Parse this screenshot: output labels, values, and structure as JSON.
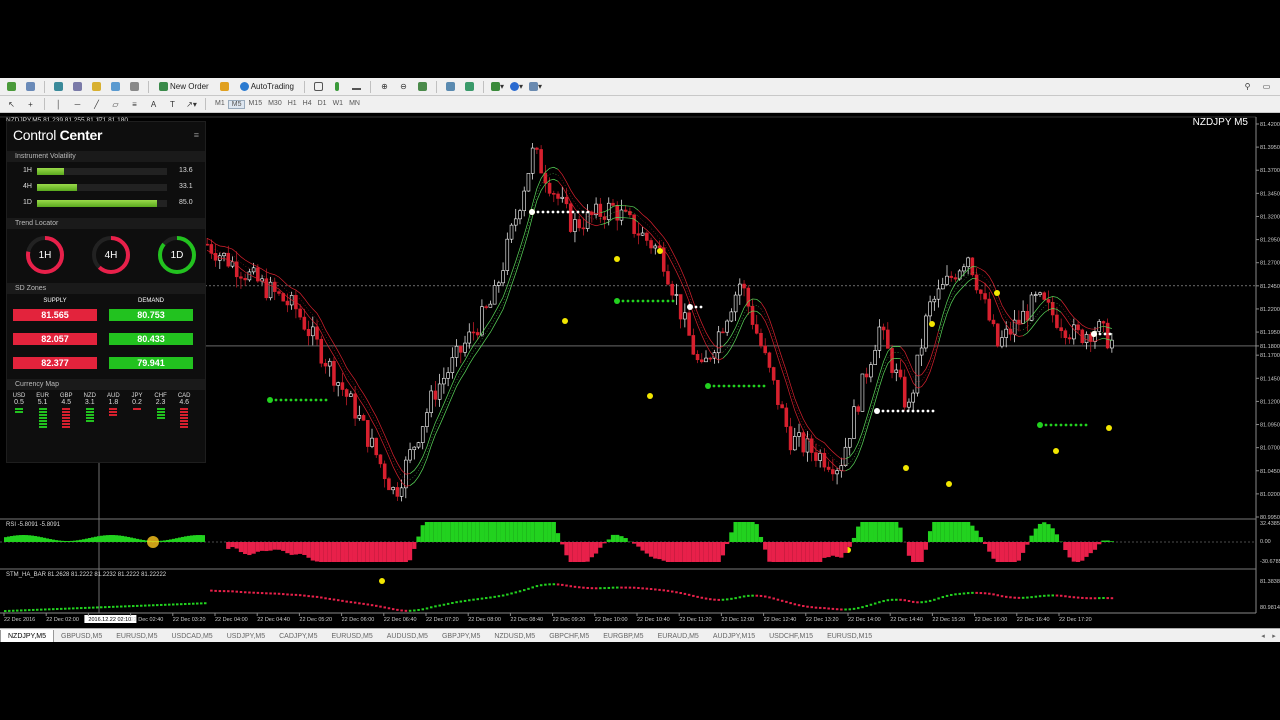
{
  "toolbar": {
    "new_order_label": "New Order",
    "autotrading_label": "AutoTrading",
    "timeframes": [
      "M1",
      "M5",
      "M15",
      "M30",
      "H1",
      "H4",
      "D1",
      "W1",
      "MN"
    ],
    "active_timeframe": "M5"
  },
  "chart": {
    "info": "NZDJPY,M5  81.239 81.255 81.171 81.180",
    "symbol_label": "NZDJPY M5",
    "price_labels": [
      "81.4200",
      "81.3950",
      "81.3700",
      "81.3450",
      "81.3200",
      "81.2950",
      "81.2700",
      "81.2450",
      "81.2200",
      "81.1950",
      "81.1800",
      "81.1700",
      "81.1450",
      "81.1200",
      "81.0950",
      "81.0700",
      "81.0450",
      "81.0200",
      "80.9950"
    ],
    "rsi_info": "RSI -5.8091 -5.8091",
    "rsi_scale": [
      "32.4385",
      "0.00",
      "-30.6785"
    ],
    "ha_info": "STM_HA_BAR 81.2628 81.2222 81.2232 81.2222 81.22222",
    "ha_scale": [
      "81.3838",
      "80.9814"
    ],
    "time_labels": [
      "22 Dec 2016",
      "22 Dec 02:00",
      "2016.12.22 02:10",
      "22 Dec 02:40",
      "22 Dec 03:20",
      "22 Dec 04:00",
      "22 Dec 04:40",
      "22 Dec 05:20",
      "22 Dec 06:00",
      "22 Dec 06:40",
      "22 Dec 07:20",
      "22 Dec 08:00",
      "22 Dec 08:40",
      "22 Dec 09:20",
      "22 Dec 10:00",
      "22 Dec 10:40",
      "22 Dec 11:20",
      "22 Dec 12:00",
      "22 Dec 12:40",
      "22 Dec 13:20",
      "22 Dec 14:00",
      "22 Dec 14:40",
      "22 Dec 15:20",
      "22 Dec 16:00",
      "22 Dec 16:40",
      "22 Dec 17:20"
    ],
    "colors": {
      "bull": "#ffffff",
      "bear": "#d7202e",
      "green": "#22d21f",
      "yellow": "#f2e600"
    }
  },
  "control_center": {
    "title_a": "Control",
    "title_b": "Center",
    "volatility_title": "Instrument Volatility",
    "volatility": [
      {
        "label": "1H",
        "value": "13.6",
        "pct": 0.21
      },
      {
        "label": "4H",
        "value": "33.1",
        "pct": 0.31
      },
      {
        "label": "1D",
        "value": "85.0",
        "pct": 0.92
      }
    ],
    "trend_title": "Trend Locator",
    "trend": [
      {
        "label": "1H",
        "color": "#e8204a",
        "level": 0.78
      },
      {
        "label": "4H",
        "color": "#e8204a",
        "level": 0.62
      },
      {
        "label": "1D",
        "color": "#22c21f",
        "level": 0.86
      }
    ],
    "sd_title": "SD Zones",
    "supply_label": "SUPPLY",
    "demand_label": "DEMAND",
    "supply": [
      "81.565",
      "82.057",
      "82.377"
    ],
    "demand": [
      "80.753",
      "80.433",
      "79.941"
    ],
    "currency_title": "Currency Map",
    "currencies": [
      {
        "code": "USD",
        "value": "0.5",
        "green": 2,
        "red": 0
      },
      {
        "code": "EUR",
        "value": "5.1",
        "green": 7,
        "red": 0
      },
      {
        "code": "GBP",
        "value": "4.5",
        "green": 0,
        "red": 7
      },
      {
        "code": "NZD",
        "value": "3.1",
        "green": 5,
        "red": 0
      },
      {
        "code": "AUD",
        "value": "1.8",
        "green": 0,
        "red": 3
      },
      {
        "code": "JPY",
        "value": "0.2",
        "green": 0,
        "red": 1
      },
      {
        "code": "CHF",
        "value": "2.3",
        "green": 4,
        "red": 0
      },
      {
        "code": "CAD",
        "value": "4.6",
        "green": 0,
        "red": 7
      }
    ]
  },
  "tabs": [
    "NZDJPY,M5",
    "GBPUSD,M5",
    "EURUSD,M5",
    "USDCAD,M5",
    "USDJPY,M5",
    "CADJPY,M5",
    "EURUSD,M5",
    "AUDUSD,M5",
    "GBPJPY,M5",
    "NZDUSD,M5",
    "GBPCHF,M5",
    "EURGBP,M5",
    "EURAUD,M5",
    "AUDJPY,M15",
    "USDCHF,M15",
    "EURUSD,M15"
  ],
  "active_tab": 0
}
